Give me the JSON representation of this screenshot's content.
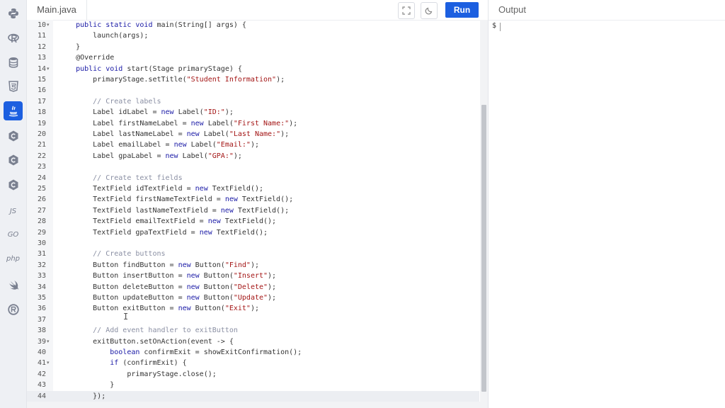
{
  "editor": {
    "file_tab": "Main.java",
    "run_label": "Run",
    "lines": [
      {
        "n": "10",
        "fold": true,
        "active": false,
        "seg": [
          {
            "t": "    ",
            "c": "plain"
          },
          {
            "t": "public static void",
            "c": "kw"
          },
          {
            "t": " main(String[] args) {",
            "c": "plain"
          }
        ]
      },
      {
        "n": "11",
        "fold": false,
        "active": false,
        "seg": [
          {
            "t": "        launch(args);",
            "c": "plain"
          }
        ]
      },
      {
        "n": "12",
        "fold": false,
        "active": false,
        "seg": [
          {
            "t": "    }",
            "c": "plain"
          }
        ]
      },
      {
        "n": "13",
        "fold": false,
        "active": false,
        "seg": [
          {
            "t": "    @Override",
            "c": "plain"
          }
        ]
      },
      {
        "n": "14",
        "fold": true,
        "active": false,
        "seg": [
          {
            "t": "    ",
            "c": "plain"
          },
          {
            "t": "public void",
            "c": "kw"
          },
          {
            "t": " start(Stage primaryStage) {",
            "c": "plain"
          }
        ]
      },
      {
        "n": "15",
        "fold": false,
        "active": false,
        "seg": [
          {
            "t": "        primaryStage.setTitle(",
            "c": "plain"
          },
          {
            "t": "\"Student Information\"",
            "c": "str"
          },
          {
            "t": ");",
            "c": "plain"
          }
        ]
      },
      {
        "n": "16",
        "fold": false,
        "active": false,
        "seg": []
      },
      {
        "n": "17",
        "fold": false,
        "active": false,
        "seg": [
          {
            "t": "        // Create labels",
            "c": "com"
          }
        ]
      },
      {
        "n": "18",
        "fold": false,
        "active": false,
        "seg": [
          {
            "t": "        Label idLabel = ",
            "c": "plain"
          },
          {
            "t": "new",
            "c": "kw"
          },
          {
            "t": " Label(",
            "c": "plain"
          },
          {
            "t": "\"ID:\"",
            "c": "str"
          },
          {
            "t": ");",
            "c": "plain"
          }
        ]
      },
      {
        "n": "19",
        "fold": false,
        "active": false,
        "seg": [
          {
            "t": "        Label firstNameLabel = ",
            "c": "plain"
          },
          {
            "t": "new",
            "c": "kw"
          },
          {
            "t": " Label(",
            "c": "plain"
          },
          {
            "t": "\"First Name:\"",
            "c": "str"
          },
          {
            "t": ");",
            "c": "plain"
          }
        ]
      },
      {
        "n": "20",
        "fold": false,
        "active": false,
        "seg": [
          {
            "t": "        Label lastNameLabel = ",
            "c": "plain"
          },
          {
            "t": "new",
            "c": "kw"
          },
          {
            "t": " Label(",
            "c": "plain"
          },
          {
            "t": "\"Last Name:\"",
            "c": "str"
          },
          {
            "t": ");",
            "c": "plain"
          }
        ]
      },
      {
        "n": "21",
        "fold": false,
        "active": false,
        "seg": [
          {
            "t": "        Label emailLabel = ",
            "c": "plain"
          },
          {
            "t": "new",
            "c": "kw"
          },
          {
            "t": " Label(",
            "c": "plain"
          },
          {
            "t": "\"Email:\"",
            "c": "str"
          },
          {
            "t": ");",
            "c": "plain"
          }
        ]
      },
      {
        "n": "22",
        "fold": false,
        "active": false,
        "seg": [
          {
            "t": "        Label gpaLabel = ",
            "c": "plain"
          },
          {
            "t": "new",
            "c": "kw"
          },
          {
            "t": " Label(",
            "c": "plain"
          },
          {
            "t": "\"GPA:\"",
            "c": "str"
          },
          {
            "t": ");",
            "c": "plain"
          }
        ]
      },
      {
        "n": "23",
        "fold": false,
        "active": false,
        "seg": []
      },
      {
        "n": "24",
        "fold": false,
        "active": false,
        "seg": [
          {
            "t": "        // Create text fields",
            "c": "com"
          }
        ]
      },
      {
        "n": "25",
        "fold": false,
        "active": false,
        "seg": [
          {
            "t": "        TextField idTextField = ",
            "c": "plain"
          },
          {
            "t": "new",
            "c": "kw"
          },
          {
            "t": " TextField();",
            "c": "plain"
          }
        ]
      },
      {
        "n": "26",
        "fold": false,
        "active": false,
        "seg": [
          {
            "t": "        TextField firstNameTextField = ",
            "c": "plain"
          },
          {
            "t": "new",
            "c": "kw"
          },
          {
            "t": " TextField();",
            "c": "plain"
          }
        ]
      },
      {
        "n": "27",
        "fold": false,
        "active": false,
        "seg": [
          {
            "t": "        TextField lastNameTextField = ",
            "c": "plain"
          },
          {
            "t": "new",
            "c": "kw"
          },
          {
            "t": " TextField();",
            "c": "plain"
          }
        ]
      },
      {
        "n": "28",
        "fold": false,
        "active": false,
        "seg": [
          {
            "t": "        TextField emailTextField = ",
            "c": "plain"
          },
          {
            "t": "new",
            "c": "kw"
          },
          {
            "t": " TextField();",
            "c": "plain"
          }
        ]
      },
      {
        "n": "29",
        "fold": false,
        "active": false,
        "seg": [
          {
            "t": "        TextField gpaTextField = ",
            "c": "plain"
          },
          {
            "t": "new",
            "c": "kw"
          },
          {
            "t": " TextField();",
            "c": "plain"
          }
        ]
      },
      {
        "n": "30",
        "fold": false,
        "active": false,
        "seg": []
      },
      {
        "n": "31",
        "fold": false,
        "active": false,
        "seg": [
          {
            "t": "        // Create buttons",
            "c": "com"
          }
        ]
      },
      {
        "n": "32",
        "fold": false,
        "active": false,
        "seg": [
          {
            "t": "        Button findButton = ",
            "c": "plain"
          },
          {
            "t": "new",
            "c": "kw"
          },
          {
            "t": " Button(",
            "c": "plain"
          },
          {
            "t": "\"Find\"",
            "c": "str"
          },
          {
            "t": ");",
            "c": "plain"
          }
        ]
      },
      {
        "n": "33",
        "fold": false,
        "active": false,
        "seg": [
          {
            "t": "        Button insertButton = ",
            "c": "plain"
          },
          {
            "t": "new",
            "c": "kw"
          },
          {
            "t": " Button(",
            "c": "plain"
          },
          {
            "t": "\"Insert\"",
            "c": "str"
          },
          {
            "t": ");",
            "c": "plain"
          }
        ]
      },
      {
        "n": "34",
        "fold": false,
        "active": false,
        "seg": [
          {
            "t": "        Button deleteButton = ",
            "c": "plain"
          },
          {
            "t": "new",
            "c": "kw"
          },
          {
            "t": " Button(",
            "c": "plain"
          },
          {
            "t": "\"Delete\"",
            "c": "str"
          },
          {
            "t": ");",
            "c": "plain"
          }
        ]
      },
      {
        "n": "35",
        "fold": false,
        "active": false,
        "seg": [
          {
            "t": "        Button updateButton = ",
            "c": "plain"
          },
          {
            "t": "new",
            "c": "kw"
          },
          {
            "t": " Button(",
            "c": "plain"
          },
          {
            "t": "\"Update\"",
            "c": "str"
          },
          {
            "t": ");",
            "c": "plain"
          }
        ]
      },
      {
        "n": "36",
        "fold": false,
        "active": false,
        "seg": [
          {
            "t": "        Button exitButton = ",
            "c": "plain"
          },
          {
            "t": "new",
            "c": "kw"
          },
          {
            "t": " Button(",
            "c": "plain"
          },
          {
            "t": "\"Exit\"",
            "c": "str"
          },
          {
            "t": ");",
            "c": "plain"
          }
        ]
      },
      {
        "n": "37",
        "fold": false,
        "active": false,
        "seg": []
      },
      {
        "n": "38",
        "fold": false,
        "active": false,
        "seg": [
          {
            "t": "        // Add event handler to exitButton",
            "c": "com"
          }
        ]
      },
      {
        "n": "39",
        "fold": true,
        "active": false,
        "seg": [
          {
            "t": "        exitButton.setOnAction(event -> {",
            "c": "plain"
          }
        ]
      },
      {
        "n": "40",
        "fold": false,
        "active": false,
        "seg": [
          {
            "t": "            ",
            "c": "plain"
          },
          {
            "t": "boolean",
            "c": "kw"
          },
          {
            "t": " confirmExit = showExitConfirmation();",
            "c": "plain"
          }
        ]
      },
      {
        "n": "41",
        "fold": true,
        "active": false,
        "seg": [
          {
            "t": "            ",
            "c": "plain"
          },
          {
            "t": "if",
            "c": "kw"
          },
          {
            "t": " (confirmExit) {",
            "c": "plain"
          }
        ]
      },
      {
        "n": "42",
        "fold": false,
        "active": false,
        "seg": [
          {
            "t": "                primaryStage.close();",
            "c": "plain"
          }
        ]
      },
      {
        "n": "43",
        "fold": false,
        "active": false,
        "seg": [
          {
            "t": "            }",
            "c": "plain"
          }
        ]
      },
      {
        "n": "44",
        "fold": false,
        "active": true,
        "seg": [
          {
            "t": "        });",
            "c": "plain"
          }
        ]
      }
    ]
  },
  "output": {
    "title": "Output",
    "prompt": "$"
  },
  "sidebar": {
    "items": [
      {
        "name": "python-icon",
        "kind": "python",
        "active": false
      },
      {
        "name": "r-icon",
        "kind": "r",
        "active": false
      },
      {
        "name": "database-icon",
        "kind": "db",
        "active": false
      },
      {
        "name": "html5-icon",
        "kind": "html",
        "active": false
      },
      {
        "name": "java-icon",
        "kind": "java",
        "active": true
      },
      {
        "name": "c-icon",
        "kind": "c",
        "active": false
      },
      {
        "name": "cpp-icon",
        "kind": "c",
        "active": false
      },
      {
        "name": "csharp-icon",
        "kind": "c",
        "active": false
      },
      {
        "name": "javascript-icon",
        "kind": "text",
        "label": "JS",
        "active": false
      },
      {
        "name": "go-icon",
        "kind": "text",
        "label": "GO",
        "active": false
      },
      {
        "name": "php-icon",
        "kind": "text",
        "label": "php",
        "active": false
      },
      {
        "name": "swift-icon",
        "kind": "swift",
        "active": false
      },
      {
        "name": "rust-icon",
        "kind": "rust",
        "active": false
      }
    ]
  },
  "colors": {
    "accent": "#1c5fe0",
    "keyword": "#1a1aa6",
    "string": "#a31515",
    "comment": "#8a8fa3",
    "plain": "#333333"
  }
}
